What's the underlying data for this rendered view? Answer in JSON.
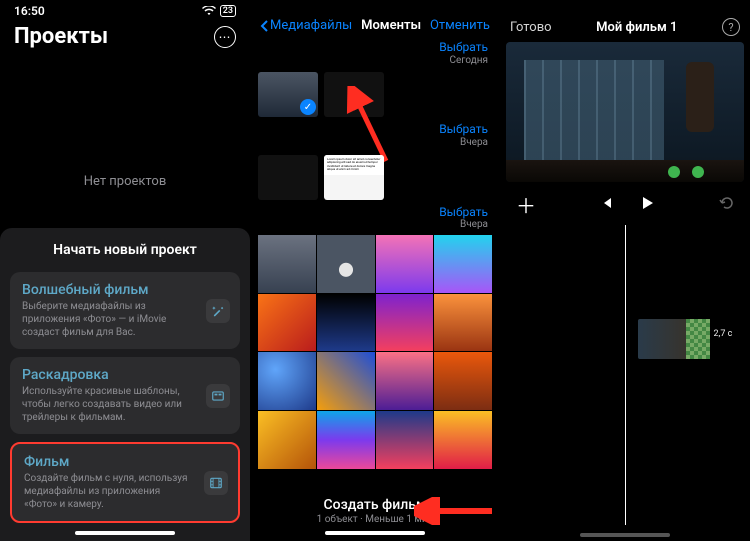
{
  "pane1": {
    "status": {
      "time": "16:50",
      "battery": "23"
    },
    "title": "Проекты",
    "empty": "Нет проектов",
    "sheet_title": "Начать новый проект",
    "options": [
      {
        "title": "Волшебный фильм",
        "desc": "Выберите медиафайлы из приложения «Фото» — и iMovie создаст фильм для Вас.",
        "icon": "wand"
      },
      {
        "title": "Раскадровка",
        "desc": "Используйте красивые шаблоны, чтобы легко создавать видео или трейлеры к фильмам.",
        "icon": "storyboard"
      },
      {
        "title": "Фильм",
        "desc": "Создайте фильм с нуля, используя медиафайлы из приложения «Фото» и камеру.",
        "icon": "film"
      }
    ]
  },
  "pane2": {
    "back": "Медиафайлы",
    "mid": "Моменты",
    "cancel": "Отменить",
    "select": "Выбрать",
    "today": "Сегодня",
    "yesterday": "Вчера",
    "create": "Создать фильм",
    "meta": "1 объект · Меньше 1 мин"
  },
  "pane3": {
    "done": "Готово",
    "title": "Мой фильм 1",
    "clip_len": "2,7 с"
  }
}
